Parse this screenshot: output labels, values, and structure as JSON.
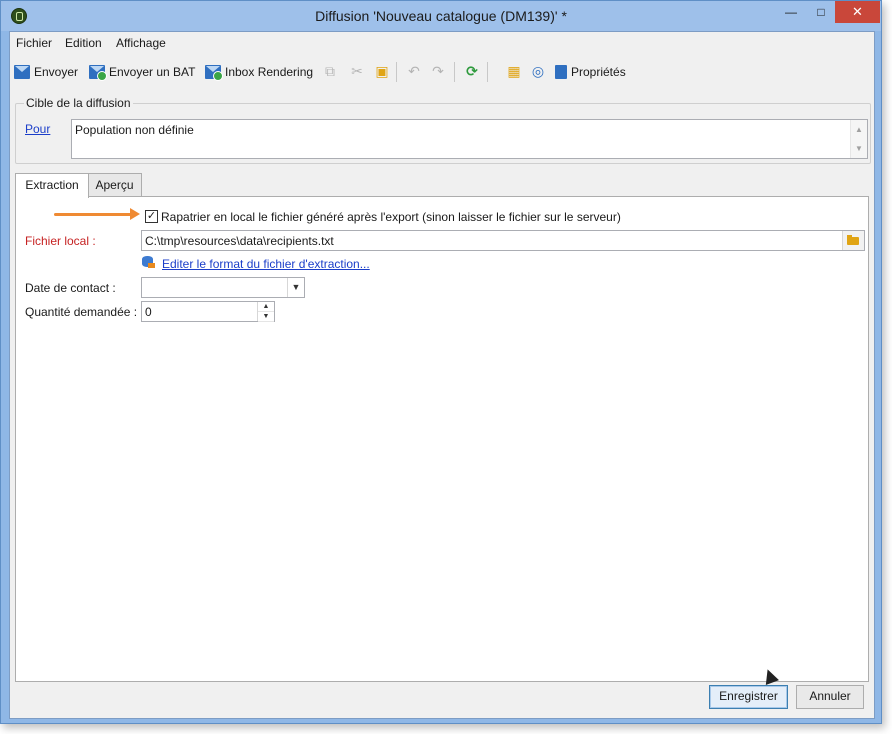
{
  "window": {
    "title": "Diffusion 'Nouveau catalogue (DM139)' *",
    "minimize_glyph": "—",
    "maximize_glyph": "□",
    "close_glyph": "✕"
  },
  "menubar": {
    "items": [
      "Fichier",
      "Edition",
      "Affichage"
    ]
  },
  "toolbar": {
    "send_label": "Envoyer",
    "send_bat_label": "Envoyer un BAT",
    "inbox_rendering_label": "Inbox Rendering",
    "properties_label": "Propriétés"
  },
  "target": {
    "legend": "Cible de la diffusion",
    "pour_link": "Pour",
    "population_text": "Population non définie"
  },
  "tabs": [
    "Extraction",
    "Aperçu"
  ],
  "extraction": {
    "checkbox_checked": true,
    "checkbox_label": "Rapatrier en local le fichier généré après l'export (sinon laisser le fichier sur le serveur)",
    "local_file_label": "Fichier local :",
    "local_file_value": "C:\\tmp\\resources\\data\\recipients.txt",
    "edit_format_link": "Editer le format du fichier d'extraction...",
    "contact_date_label": "Date de contact :",
    "contact_date_value": "",
    "quantity_label": "Quantité demandée :",
    "quantity_value": "0"
  },
  "footer": {
    "save_label": "Enregistrer",
    "cancel_label": "Annuler"
  },
  "colors": {
    "accent_arrow": "#ef8a33",
    "required_label": "#c62222",
    "link": "#1b3ec9",
    "titlebar": "#9ec0ea"
  }
}
